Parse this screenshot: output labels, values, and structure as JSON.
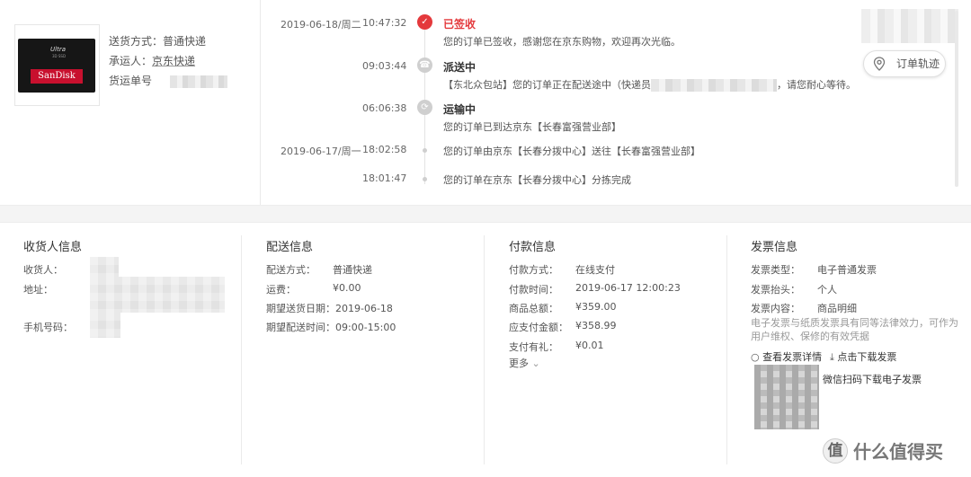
{
  "shipment": {
    "method_label": "送货方式：",
    "method_value": "普通快递",
    "carrier_label": "承运人：",
    "carrier_value": "京东快递",
    "tracking_label": "货运单号",
    "product_image": {
      "brand": "SanDisk",
      "model": "Ultra",
      "sub": "3D SSD"
    }
  },
  "tracking": {
    "button_label": "订单轨迹",
    "events": [
      {
        "date": "2019-06-18/周二",
        "time": "10:47:32",
        "title": "已签收",
        "desc": "您的订单已签收，感谢您在京东购物，欢迎再次光临。",
        "icon": "check-icon",
        "active": true
      },
      {
        "date": "",
        "time": "09:03:44",
        "title": "派送中",
        "desc_pre": "【东北众包站】您的订单正在配送途中（快递员",
        "desc_post": "，请您耐心等待。",
        "icon": "delivery-icon",
        "active": false
      },
      {
        "date": "",
        "time": "06:06:38",
        "title": "运输中",
        "desc": "您的订单已到达京东【长春富强营业部】",
        "icon": "transit-icon",
        "active": false
      },
      {
        "date": "2019-06-17/周一",
        "time": "18:02:58",
        "title": "",
        "desc": "您的订单由京东【长春分拨中心】送往【长春富强营业部】",
        "icon": "dot-icon",
        "active": false
      },
      {
        "date": "",
        "time": "18:01:47",
        "title": "",
        "desc": "您的订单在京东【长春分拨中心】分拣完成",
        "icon": "dot-icon",
        "active": false
      }
    ]
  },
  "consignee": {
    "heading": "收货人信息",
    "receiver_label": "收货人：",
    "address_label": "地址：",
    "phone_label": "手机号码："
  },
  "delivery": {
    "heading": "配送信息",
    "rows": [
      {
        "k": "配送方式：",
        "v": "普通快递"
      },
      {
        "k": "运费：",
        "v": "¥0.00"
      },
      {
        "k": "期望送货日期：",
        "v": "2019-06-18"
      },
      {
        "k": "期望配送时间：",
        "v": "09:00-15:00"
      }
    ]
  },
  "payment": {
    "heading": "付款信息",
    "rows": [
      {
        "k": "付款方式：",
        "v": "在线支付"
      },
      {
        "k": "付款时间：",
        "v": "2019-06-17 12:00:23"
      },
      {
        "k": "商品总额：",
        "v": "¥359.00"
      },
      {
        "k": "应支付金额：",
        "v": "¥358.99"
      },
      {
        "k": "支付有礼：",
        "v": "¥0.01"
      }
    ],
    "more_label": "更多"
  },
  "invoice": {
    "heading": "发票信息",
    "rows": [
      {
        "k": "发票类型：",
        "v": "电子普通发票"
      },
      {
        "k": "发票抬头：",
        "v": "个人"
      },
      {
        "k": "发票内容：",
        "v": "商品明细"
      }
    ],
    "note": "电子发票与纸质发票具有同等法律效力，可作为用户维权、保修的有效凭据",
    "view_details": "查看发票详情",
    "download": "点击下载发票",
    "wechat_scan": "微信扫码下载电子发票"
  },
  "watermark": {
    "mark": "值",
    "text": "什么值得买"
  }
}
